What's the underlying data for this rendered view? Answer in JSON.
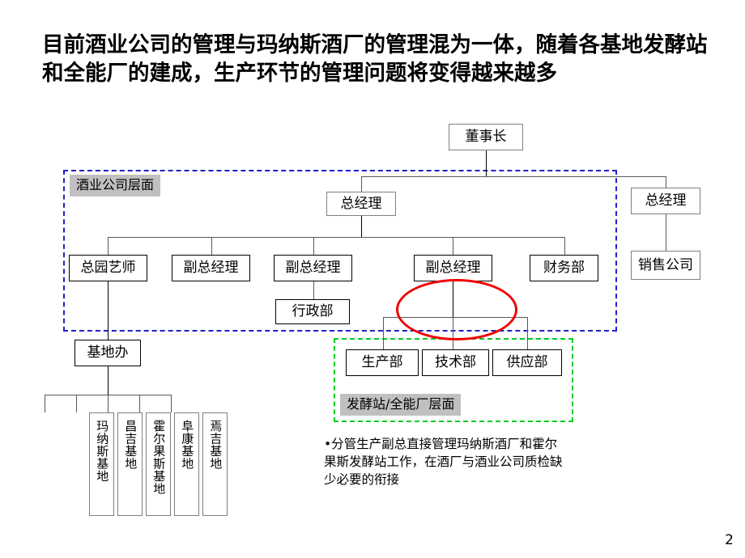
{
  "slide": {
    "title": "目前酒业公司的管理与玛纳斯酒厂的管理混为一体，随着各基地发酵站和全能厂的建成，生产环节的管理问题将变得越来越多",
    "page_number": "2"
  },
  "org_chart": {
    "type": "org-chart",
    "nodes": {
      "chairman": "董事长",
      "gm_left": "总经理",
      "gm_right": "总经理",
      "chief_horticulturist": "总园艺师",
      "deputy_gm_1": "副总经理",
      "deputy_gm_2": "副总经理",
      "deputy_gm_3": "副总经理",
      "finance_dept": "财务部",
      "sales_company": "销售公司",
      "admin_dept": "行政部",
      "base_office": "基地办",
      "production_dept": "生产部",
      "technology_dept": "技术部",
      "supply_dept": "供应部"
    },
    "bases": [
      "玛纳斯基地",
      "昌吉基地",
      "霍尔果斯基地",
      "阜康基地",
      "焉吉基地"
    ],
    "regions": {
      "wine_company_level": "酒业公司层面",
      "fermentation_plant_level": "发酵站/全能厂层面"
    },
    "highlight": {
      "shape": "ellipse",
      "color": "#ee0000",
      "targets": [
        "副总经理",
        "生产部",
        "技术部",
        "供应部"
      ]
    },
    "colors": {
      "region_blue": "#2020cc",
      "region_green": "#00cc22",
      "region_label_bg": "#c0c0c0",
      "box_border": "#808080",
      "highlight_red": "#ee0000"
    }
  },
  "note": {
    "bullet": "•分管生产副总直接管理玛纳斯酒厂和霍尔果斯发酵站工作，在酒厂与酒业公司质检缺少必要的衔接"
  }
}
